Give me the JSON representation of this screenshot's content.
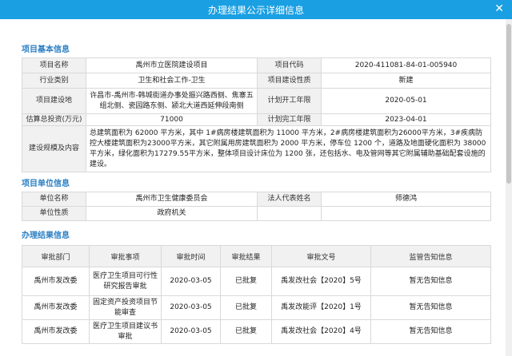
{
  "window": {
    "title": "办理结果公示详细信息",
    "close_icon": "close-icon"
  },
  "basic": {
    "section_title": "项目基本信息",
    "project_name_label": "项目名称",
    "project_name": "禹州市立医院建设项目",
    "project_code_label": "项目代码",
    "project_code": "2020-411081-84-01-005940",
    "industry_label": "行业类别",
    "industry": "卫生和社会工作-卫生",
    "nature_label": "项目建设性质",
    "nature": "新建",
    "location_label": "项目建设地",
    "location": "许昌市-禹州市-韩城街道办事处振兴路西侧、焦寨五组北侧、瓷园路东侧、颍北大道西延伸段南侧",
    "start_label": "计划开工年限",
    "start": "2020-05-01",
    "investment_label": "估算总投资(万元)",
    "investment": "71000",
    "finish_label": "计划完工年限",
    "finish": "2023-04-01",
    "scale_label": "建设规模及内容",
    "scale": "总建筑面积为 62000 平方米，其中 1#病房楼建筑面积为 11000 平方米，2#病房楼建筑面积为26000平方米，3#疾病防控大楼建筑面积为23000平方米，其它附属用房建筑面积为 2000 平方米，停车位 1200 个，道路及地面硬化面积为 38000平方米，绿化面积为17279.55平方米，整体项目设计床位为 1200 张，还包括水、电及管网等其它附属辅助基础配套设施的建设。"
  },
  "unit": {
    "section_title": "项目单位信息",
    "name_label": "单位名称",
    "name": "禹州市卫生健康委员会",
    "rep_label": "法人代表姓名",
    "rep": "师德鸿",
    "type_label": "单位性质",
    "type": "政府机关"
  },
  "results": {
    "section_title": "办理结果信息",
    "headers": [
      "审批部门",
      "审批事项",
      "审批时间",
      "审批结果",
      "审批文号",
      "监管告知信息"
    ],
    "rows": [
      {
        "dept": "禹州市发改委",
        "item": "医疗卫生项目可行性研究报告审批",
        "time": "2020-03-05",
        "result": "已批复",
        "doc": "禹发改社会【2020】5号",
        "notice": "暂无告知信息"
      },
      {
        "dept": "禹州市发改委",
        "item": "固定资产投资项目节能审查",
        "time": "2020-03-05",
        "result": "已批复",
        "doc": "禹发改能评【2020】1号",
        "notice": "暂无告知信息"
      },
      {
        "dept": "禹州市发改委",
        "item": "医疗卫生项目建议书审批",
        "time": "2020-03-05",
        "result": "已批复",
        "doc": "禹发改社会【2020】4号",
        "notice": "暂无告知信息"
      }
    ]
  },
  "colors": {
    "titlebar": "#1a9fe3",
    "section": "#2b7fc2",
    "label_bg": "#f1f1f1",
    "border": "#d9d9d9"
  }
}
